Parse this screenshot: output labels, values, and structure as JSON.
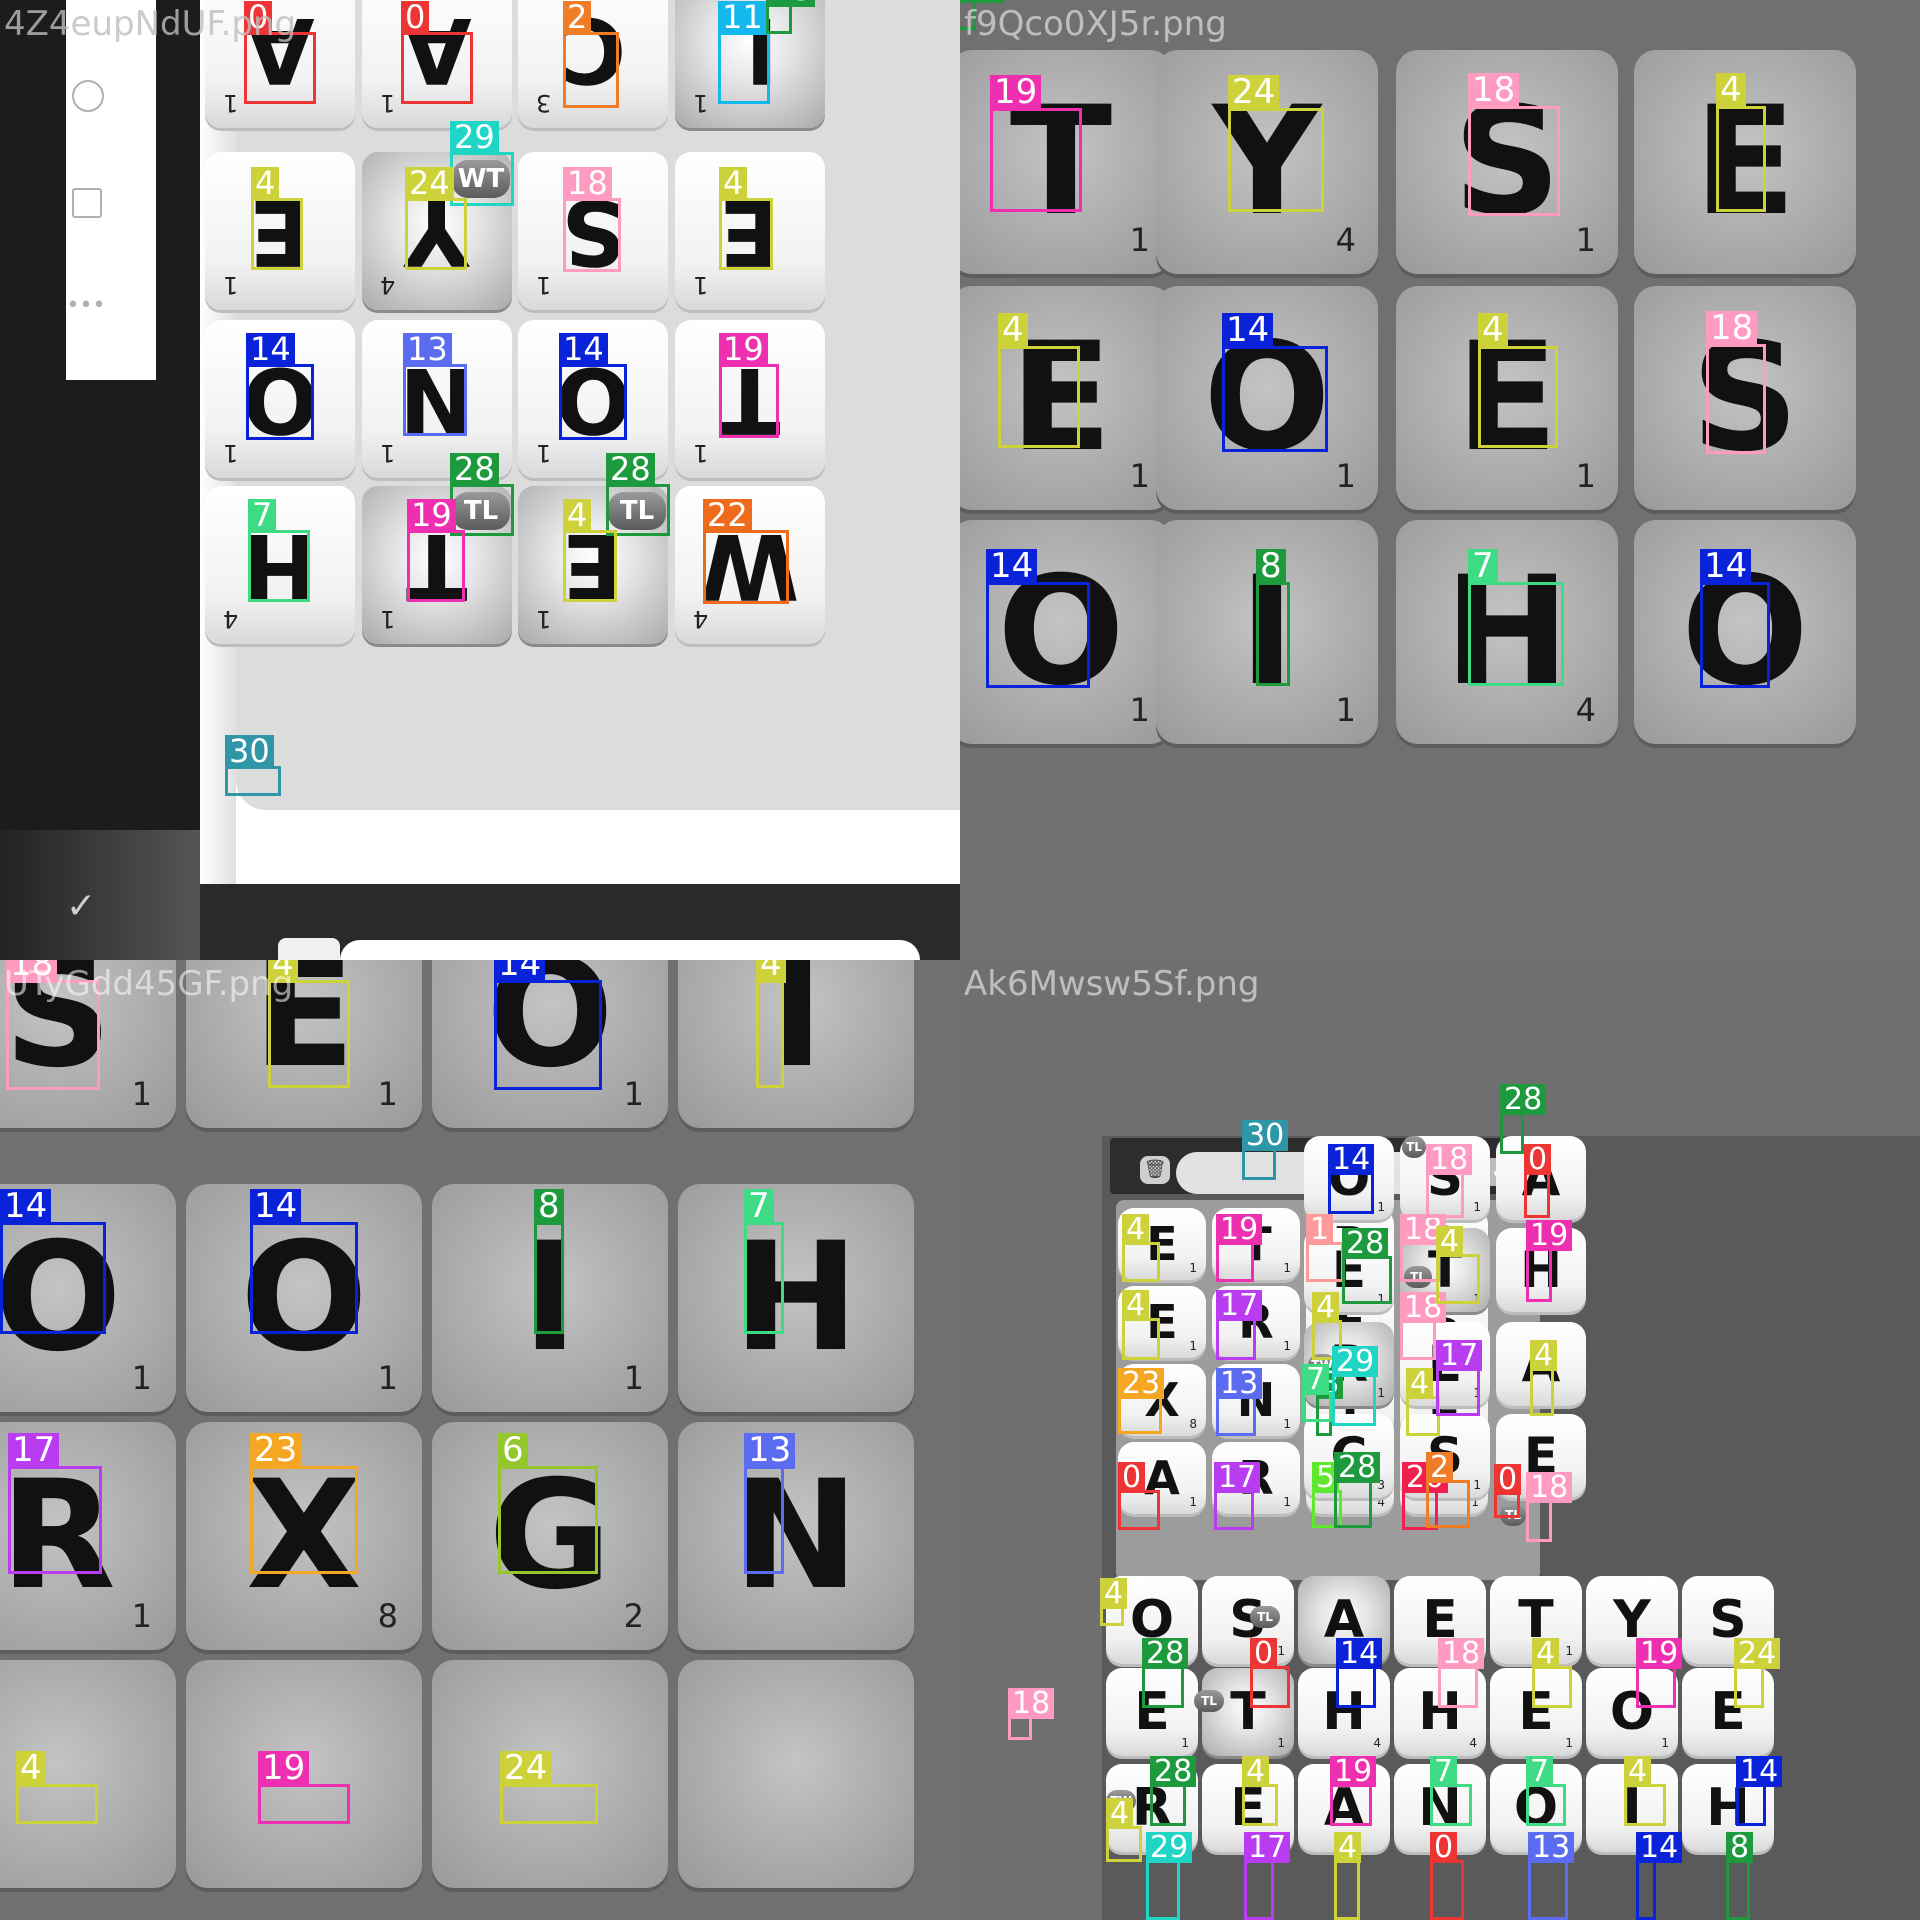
{
  "panels": {
    "top_left": {
      "filename": "4Z4eupNdUF.png",
      "tiles": [
        {
          "letter": "A",
          "points": "1"
        },
        {
          "letter": "A",
          "points": "1"
        },
        {
          "letter": "C",
          "points": "3"
        },
        {
          "letter": "L",
          "points": "1"
        },
        {
          "letter": "E",
          "points": "1"
        },
        {
          "letter": "Y",
          "points": "4"
        },
        {
          "letter": "S",
          "points": "1"
        },
        {
          "letter": "E",
          "points": "1"
        },
        {
          "letter": "O",
          "points": "1"
        },
        {
          "letter": "N",
          "points": "1"
        },
        {
          "letter": "O",
          "points": "1"
        },
        {
          "letter": "T",
          "points": "1"
        },
        {
          "letter": "H",
          "points": "4"
        },
        {
          "letter": "T",
          "points": "1"
        },
        {
          "letter": "E",
          "points": "1"
        },
        {
          "letter": "W",
          "points": "4"
        }
      ],
      "badges": [
        "WT",
        "TL",
        "TL"
      ],
      "labels": [
        "0",
        "0",
        "2",
        "11",
        "28",
        "29",
        "4",
        "24",
        "18",
        "4",
        "14",
        "13",
        "14",
        "19",
        "28",
        "28",
        "7",
        "19",
        "4",
        "22",
        "30"
      ]
    },
    "top_right": {
      "filename": "f9Qco0XJ5r.png",
      "tiles": [
        {
          "letter": "T",
          "points": "1"
        },
        {
          "letter": "Y",
          "points": "4"
        },
        {
          "letter": "S",
          "points": "1"
        },
        {
          "letter": "E",
          "points": ""
        },
        {
          "letter": "E",
          "points": "1"
        },
        {
          "letter": "O",
          "points": "1"
        },
        {
          "letter": "E",
          "points": "1"
        },
        {
          "letter": "S",
          "points": ""
        },
        {
          "letter": "O",
          "points": "1"
        },
        {
          "letter": "I",
          "points": "1"
        },
        {
          "letter": "H",
          "points": "4"
        },
        {
          "letter": "O",
          "points": ""
        }
      ],
      "labels": [
        "28",
        "19",
        "24",
        "18",
        "4",
        "4",
        "14",
        "4",
        "18",
        "14",
        "8",
        "7",
        "14"
      ]
    },
    "bottom_left": {
      "filename": "UTyGdd45GF.png",
      "tiles": [
        {
          "letter": "S",
          "points": "1"
        },
        {
          "letter": "E",
          "points": "1"
        },
        {
          "letter": "O",
          "points": "1"
        },
        {
          "letter": "I",
          "points": ""
        },
        {
          "letter": "O",
          "points": "1"
        },
        {
          "letter": "O",
          "points": "1"
        },
        {
          "letter": "I",
          "points": "1"
        },
        {
          "letter": "H",
          "points": ""
        },
        {
          "letter": "R",
          "points": "1"
        },
        {
          "letter": "X",
          "points": "8"
        },
        {
          "letter": "G",
          "points": "2"
        },
        {
          "letter": "N",
          "points": ""
        },
        {
          "letter": "",
          "points": ""
        },
        {
          "letter": "",
          "points": ""
        },
        {
          "letter": "",
          "points": ""
        },
        {
          "letter": "",
          "points": ""
        }
      ],
      "labels": [
        "18",
        "4",
        "14",
        "4",
        "14",
        "14",
        "8",
        "7",
        "17",
        "23",
        "6",
        "13",
        "4",
        "19",
        "24"
      ]
    },
    "bottom_right": {
      "filename": "Ak6Mwsw5Sf.png",
      "rack": [
        {
          "letter": "E",
          "points": "1"
        },
        {
          "letter": "T",
          "points": "1"
        },
        {
          "letter": "B",
          "points": "3"
        },
        {
          "letter": "S",
          "points": "1"
        },
        {
          "letter": "E",
          "points": "1"
        },
        {
          "letter": "R",
          "points": "1"
        },
        {
          "letter": "E",
          "points": "1"
        },
        {
          "letter": "S",
          "points": "1"
        },
        {
          "letter": "X",
          "points": "8"
        },
        {
          "letter": "N",
          "points": "1"
        },
        {
          "letter": "I",
          "points": "1"
        },
        {
          "letter": "E",
          "points": "1"
        },
        {
          "letter": "A",
          "points": "1"
        },
        {
          "letter": "R",
          "points": "1"
        },
        {
          "letter": "F",
          "points": "4"
        },
        {
          "letter": "U",
          "points": "1"
        }
      ],
      "right_cols": [
        {
          "letter": "O",
          "points": "1"
        },
        {
          "letter": "S",
          "points": "1"
        },
        {
          "letter": "A",
          "points": ""
        },
        {
          "letter": "E",
          "points": "1"
        },
        {
          "letter": "T",
          "points": "1"
        },
        {
          "letter": "H",
          "points": ""
        },
        {
          "letter": "R",
          "points": "1"
        },
        {
          "letter": "E",
          "points": "1"
        },
        {
          "letter": "A",
          "points": ""
        },
        {
          "letter": "C",
          "points": "3"
        },
        {
          "letter": "S",
          "points": "1"
        },
        {
          "letter": "E",
          "points": ""
        }
      ],
      "bottom_rows": [
        {
          "letter": "O",
          "points": "1"
        },
        {
          "letter": "S",
          "points": "1"
        },
        {
          "letter": "A",
          "points": "1"
        },
        {
          "letter": "E",
          "points": "1"
        },
        {
          "letter": "T",
          "points": "1"
        },
        {
          "letter": "Y",
          "points": "4"
        },
        {
          "letter": "S",
          "points": ""
        },
        {
          "letter": "E",
          "points": "1"
        },
        {
          "letter": "T",
          "points": "1"
        },
        {
          "letter": "H",
          "points": "4"
        },
        {
          "letter": "H",
          "points": "4"
        },
        {
          "letter": "E",
          "points": "1"
        },
        {
          "letter": "O",
          "points": "1"
        },
        {
          "letter": "E",
          "points": ""
        },
        {
          "letter": "R",
          "points": ""
        },
        {
          "letter": "E",
          "points": ""
        },
        {
          "letter": "A",
          "points": ""
        },
        {
          "letter": "N",
          "points": ""
        },
        {
          "letter": "O",
          "points": ""
        },
        {
          "letter": "I",
          "points": ""
        },
        {
          "letter": "H",
          "points": ""
        }
      ],
      "badges": [
        "TL",
        "TL",
        "TW",
        "TL",
        "TL",
        "TL",
        "TW"
      ],
      "labels": [
        "30",
        "4",
        "19",
        "1",
        "18",
        "4",
        "17",
        "4",
        "18",
        "23",
        "13",
        "8",
        "4",
        "0",
        "17",
        "5",
        "20",
        "14",
        "18",
        "28",
        "0",
        "28",
        "4",
        "19",
        "7",
        "29",
        "17",
        "4",
        "0",
        "28",
        "2",
        "18",
        "4",
        "28",
        "0",
        "14",
        "18",
        "4",
        "19",
        "24",
        "18",
        "28",
        "4",
        "19",
        "7",
        "7",
        "4",
        "14",
        "4",
        "29",
        "17",
        "4",
        "0",
        "13",
        "14",
        "8",
        "7"
      ]
    }
  },
  "colors": {
    "0": "#ee3535",
    "1": "#ff9a9a",
    "2": "#f07c28",
    "4": "#cdd23b",
    "5": "#5ee82e",
    "6": "#93c72b",
    "7": "#3ddc84",
    "8": "#1d9a3d",
    "11": "#14b8ec",
    "13": "#5b6cf0",
    "14": "#0a22d8",
    "17": "#b93cf0",
    "18": "#ff9ac0",
    "19": "#ee2fb0",
    "20": "#f0204e",
    "22": "#ee6b1c",
    "23": "#f5a623",
    "24": "#cdd23b",
    "28": "#1d9a3d",
    "29": "#1fd6c6",
    "30": "#2f96a8"
  }
}
